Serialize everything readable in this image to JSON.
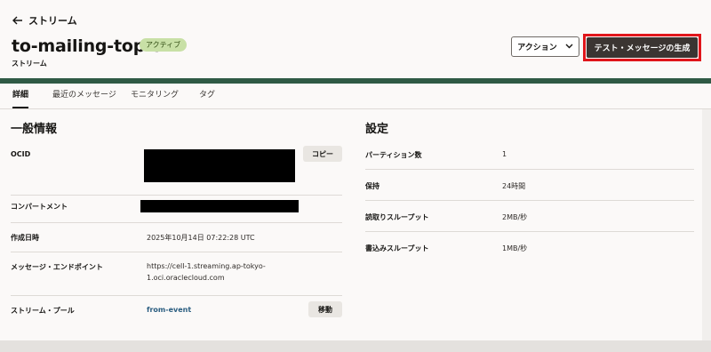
{
  "header": {
    "back_label": "ストリーム",
    "title": "to-mailing-topic",
    "status_badge": "アクティブ",
    "subtitle": "ストリーム",
    "action_button": "アクション",
    "primary_button": "テスト・メッセージの生成"
  },
  "tabs": [
    {
      "label": "詳細"
    },
    {
      "label": "最近のメッセージ"
    },
    {
      "label": "モニタリング"
    },
    {
      "label": "タグ"
    }
  ],
  "general": {
    "title": "一般情報",
    "ocid_label": "OCID",
    "copy_button": "コピー",
    "compartment_label": "コンパートメント",
    "created_label": "作成日時",
    "created_value": "2025年10月14日 07:22:28 UTC",
    "endpoint_label": "メッセージ・エンドポイント",
    "endpoint_line1": "https://cell-1.streaming.ap-tokyo-",
    "endpoint_line2": "1.oci.oraclecloud.com",
    "pool_label": "ストリーム・プール",
    "pool_value": "from-event",
    "move_button": "移動"
  },
  "settings": {
    "title": "設定",
    "partitions_label": "パーティション数",
    "partitions_value": "1",
    "retention_label": "保持",
    "retention_value": "24時間",
    "read_label": "読取りスループット",
    "read_value": "2MB/秒",
    "write_label": "書込みスループット",
    "write_value": "1MB/秒"
  },
  "colors": {
    "primary_button": "#3b3532",
    "highlight_outline": "#e0161b",
    "badge": "#c8e0a6",
    "link": "#2a5d80"
  }
}
